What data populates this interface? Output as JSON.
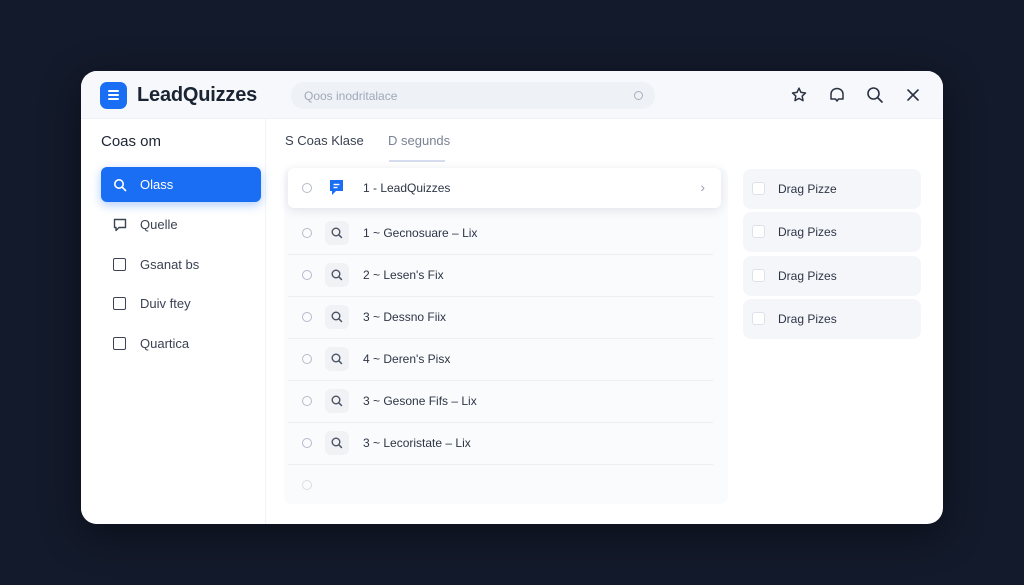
{
  "app": {
    "brand": "LeadQuizzes",
    "search_placeholder": "Qoos inodritalace"
  },
  "sidebar": {
    "title": "Coas om",
    "items": [
      {
        "label": "Olass",
        "icon": "search-icon",
        "active": true
      },
      {
        "label": "Quelle",
        "icon": "chat-icon"
      },
      {
        "label": "Gsanat bs",
        "icon": "square-icon"
      },
      {
        "label": "Duiv ftey",
        "icon": "square-icon"
      },
      {
        "label": "Quartica",
        "icon": "square-icon"
      }
    ]
  },
  "tabs": [
    {
      "label": "S Coas Klase",
      "active": true
    },
    {
      "label": "D segunds",
      "active": false
    }
  ],
  "list": [
    {
      "label": "1 - LeadQuizzes",
      "icon": "chat-icon",
      "highlighted": true
    },
    {
      "label": "1 ~ Gecnosuare – Lix",
      "icon": "search-icon"
    },
    {
      "label": "2 ~ Lesen's Fix",
      "icon": "search-icon"
    },
    {
      "label": "3 ~ Dessno Fiix",
      "icon": "search-icon"
    },
    {
      "label": "4 ~ Deren's Pisx",
      "icon": "search-icon"
    },
    {
      "label": "3 ~ Gesone Fifs – Lix",
      "icon": "search-icon"
    },
    {
      "label": "3 ~ Lecoristate – Lix",
      "icon": "search-icon"
    }
  ],
  "drag_items": [
    {
      "label": "Drag Pizze"
    },
    {
      "label": "Drag Pizes"
    },
    {
      "label": "Drag Pizes"
    },
    {
      "label": "Drag Pizes"
    }
  ],
  "colors": {
    "accent": "#1a6ef4",
    "background": "#131a2b",
    "window": "#ffffff"
  }
}
